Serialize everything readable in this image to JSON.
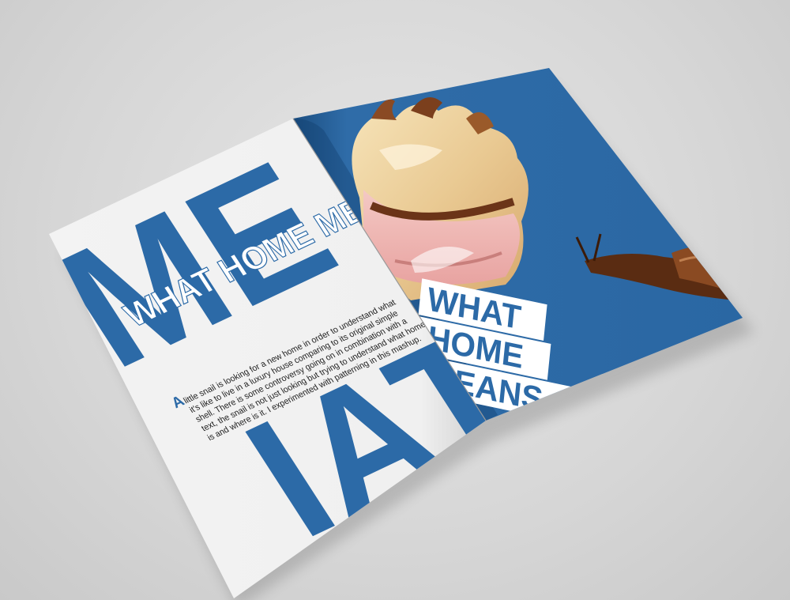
{
  "left_page": {
    "big_letters_top": "ME",
    "big_letters_bottom": "IAT",
    "title": "WHAT HOME MEANS",
    "dropcap": "A",
    "paragraph_lines": [
      "little snail is looking for a new home in order to understand what",
      "it's like to live in a luxury house comparing to its original simple",
      "shell. There is some controversy going on in combination with a",
      "text, the snail is not just looking but trying to understand what home",
      "is and where is it. I experimented with patterning in this mashup."
    ]
  },
  "right_page": {
    "title_lines": [
      "WHAT",
      "HOME",
      "MEANS"
    ]
  },
  "colors": {
    "brand_blue": "#2c6aa7",
    "page_white": "#f4f4f4",
    "background": "#d8d8d8"
  },
  "icons": [
    "seashell-illustration",
    "snail-illustration"
  ]
}
